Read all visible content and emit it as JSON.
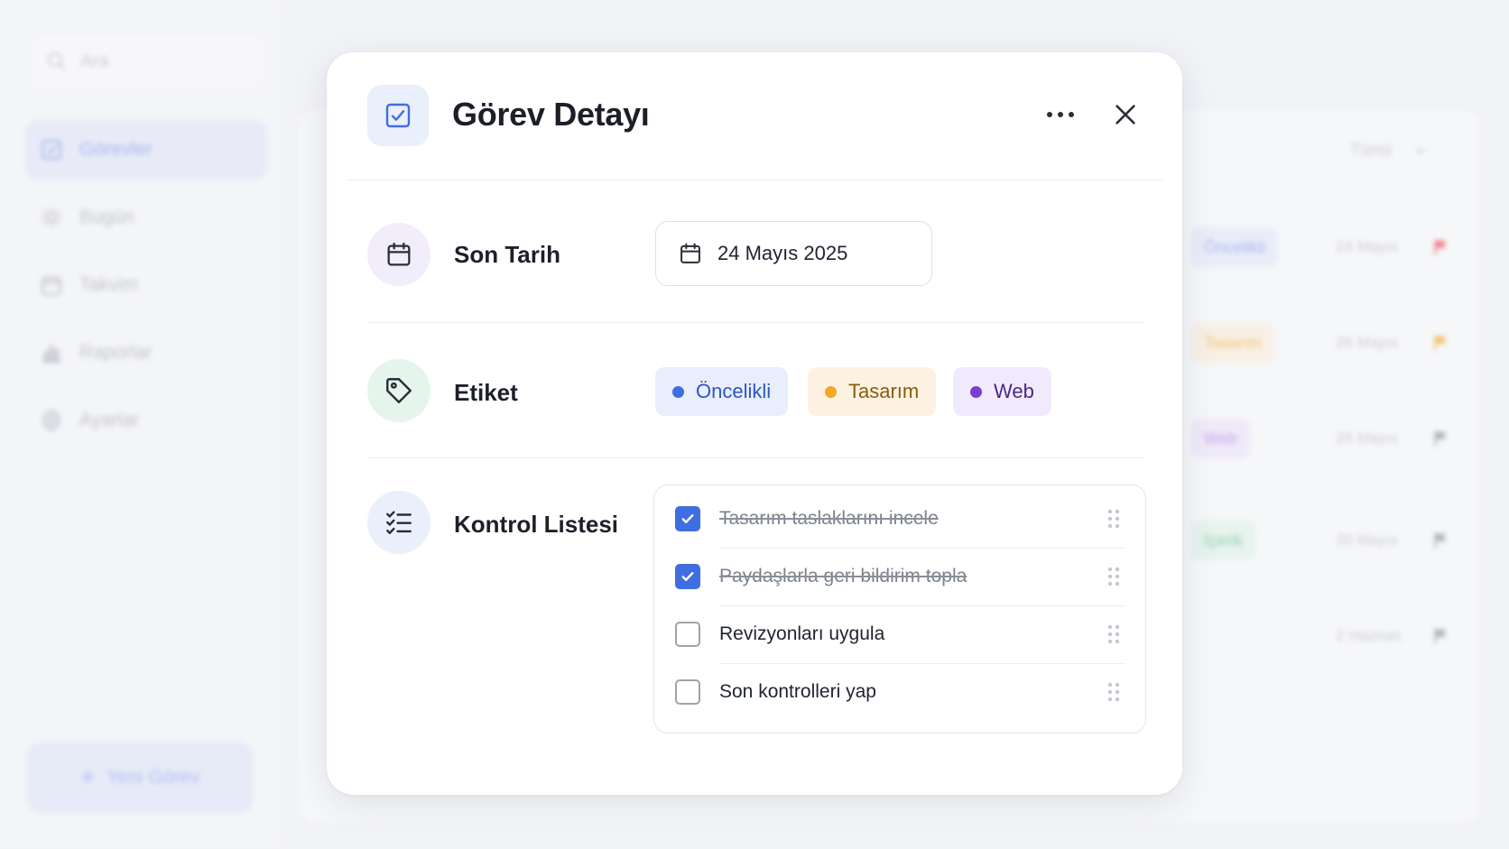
{
  "sidebar": {
    "search_placeholder": "Ara",
    "items": [
      {
        "label": "Görevler",
        "icon": "check-square-icon",
        "active": true
      },
      {
        "label": "Bugün",
        "icon": "sun-icon"
      },
      {
        "label": "Takvim",
        "icon": "calendar-icon"
      },
      {
        "label": "Raporlar",
        "icon": "bar-chart-icon"
      },
      {
        "label": "Ayarlar",
        "icon": "gear-icon"
      }
    ],
    "new_task_label": "Yeni Görev"
  },
  "task_list": {
    "filter_label": "Tümü",
    "rows": [
      {
        "tag": "Öncelikli",
        "tag_color": "#7f98e6",
        "date": "24 Mayıs",
        "flag_color": "#ef4b56"
      },
      {
        "tag": "Tasarım",
        "tag_color": "#f0ab3c",
        "date": "26 Mayıs",
        "flag_color": "#f5a623"
      },
      {
        "tag": "Web",
        "tag_color": "#a77be0",
        "date": "28 Mayıs",
        "flag_color": "#8e939d"
      },
      {
        "tag": "İçerik",
        "tag_color": "#5fc08a",
        "date": "30 Mayıs",
        "flag_color": "#8e939d"
      },
      {
        "tag": "",
        "tag_color": "",
        "date": "2 Haziran",
        "flag_color": "#8e939d"
      }
    ]
  },
  "modal": {
    "title": "Görev Detayı",
    "header_icon": "check-square-icon",
    "due_date": {
      "label": "Son Tarih",
      "value": "24 Mayıs 2025",
      "icon": "calendar-icon"
    },
    "tags": {
      "label": "Etiket",
      "icon": "tag-icon",
      "items": [
        {
          "label": "Öncelikli",
          "dot": "#3f6ee0",
          "bg": "#e8eefc",
          "text": "#2e55c6"
        },
        {
          "label": "Tasarım",
          "dot": "#f5a623",
          "bg": "#fdf2e1",
          "text": "#8a5a10"
        },
        {
          "label": "Web",
          "dot": "#7b3fd0",
          "bg": "#f1eafc",
          "text": "#4a2a86"
        }
      ]
    },
    "checklist": {
      "label": "Kontrol Listesi",
      "icon": "checklist-icon",
      "items": [
        {
          "text": "Tasarım taslaklarını incele",
          "done": true
        },
        {
          "text": "Paydaşlarla geri bildirim topla",
          "done": true
        },
        {
          "text": "Revizyonları uygula",
          "done": false
        },
        {
          "text": "Son kontrolleri yap",
          "done": false
        }
      ]
    }
  },
  "colors": {
    "accent": "#3f6ee0"
  }
}
